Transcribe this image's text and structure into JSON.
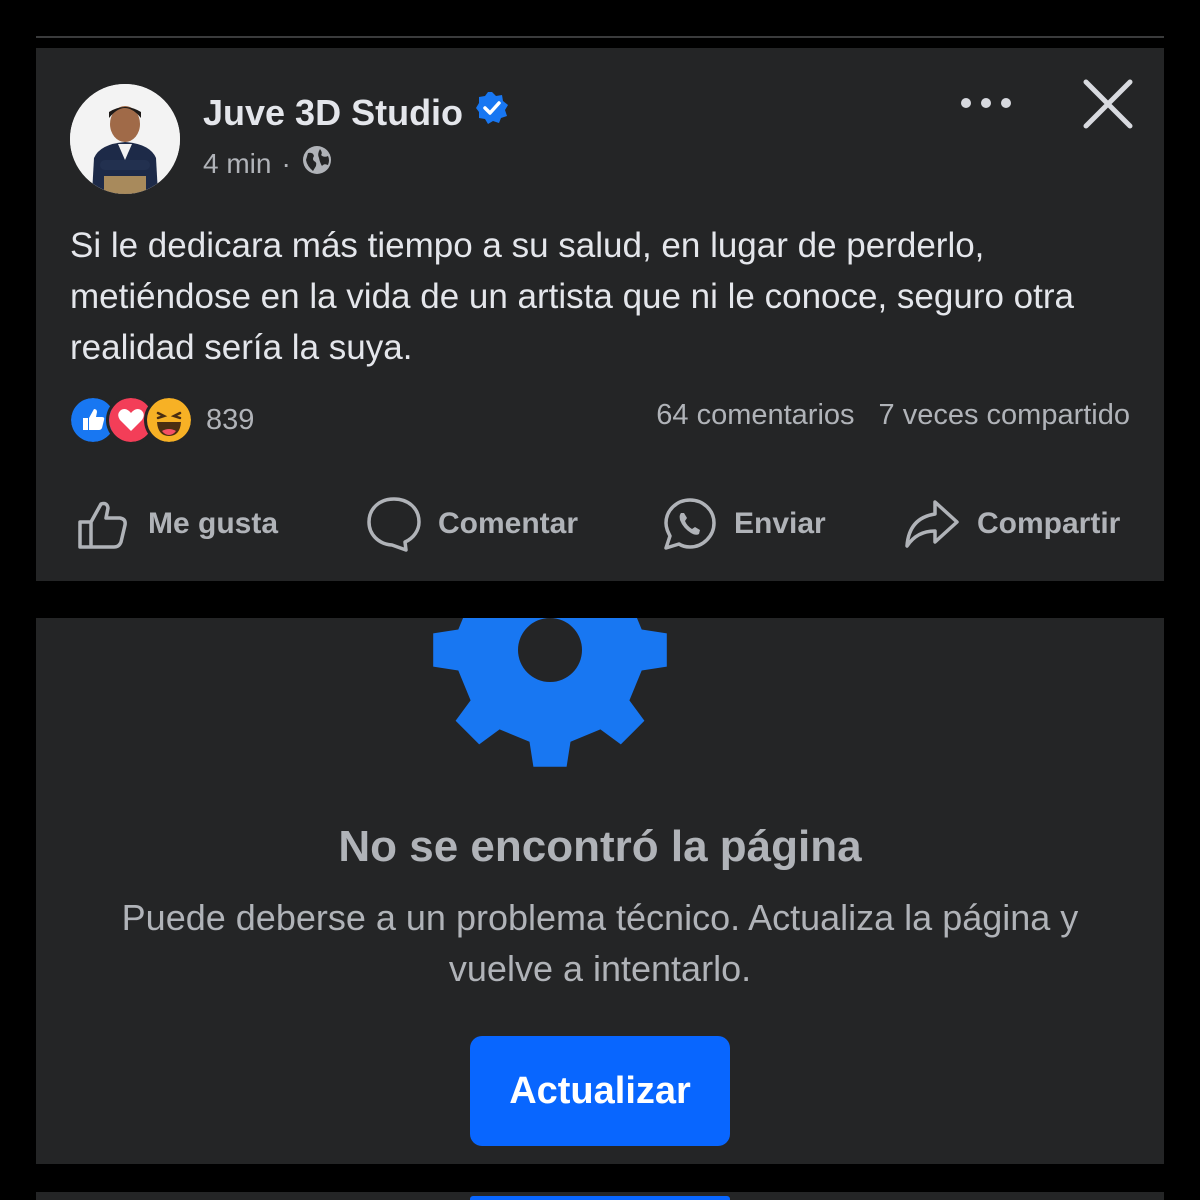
{
  "post": {
    "author": "Juve 3D Studio",
    "verified": true,
    "time": "4 min",
    "separator": "·",
    "visibility_icon": "globe-icon",
    "text": "Si le dedicara más tiempo a su salud, en lugar de perderlo, metiéndose en la vida de un artista que ni le conoce, seguro otra realidad sería la suya.",
    "reactions": {
      "types": [
        "like",
        "love",
        "haha"
      ],
      "count": "839"
    },
    "comments": "64 comentarios",
    "shares": "7 veces compartido",
    "actions": {
      "like": "Me gusta",
      "comment": "Comentar",
      "send": "Enviar",
      "share": "Compartir"
    }
  },
  "error": {
    "title": "No se encontró la página",
    "description": "Puede deberse a un problema técnico. Actualiza la página y vuelve a intentarlo.",
    "button": "Actualizar",
    "icon": "gear-icon"
  },
  "colors": {
    "background": "#000000",
    "card": "#242526",
    "primary_text": "#e4e6eb",
    "secondary_text": "#b0b3b8",
    "accent": "#0866ff"
  }
}
